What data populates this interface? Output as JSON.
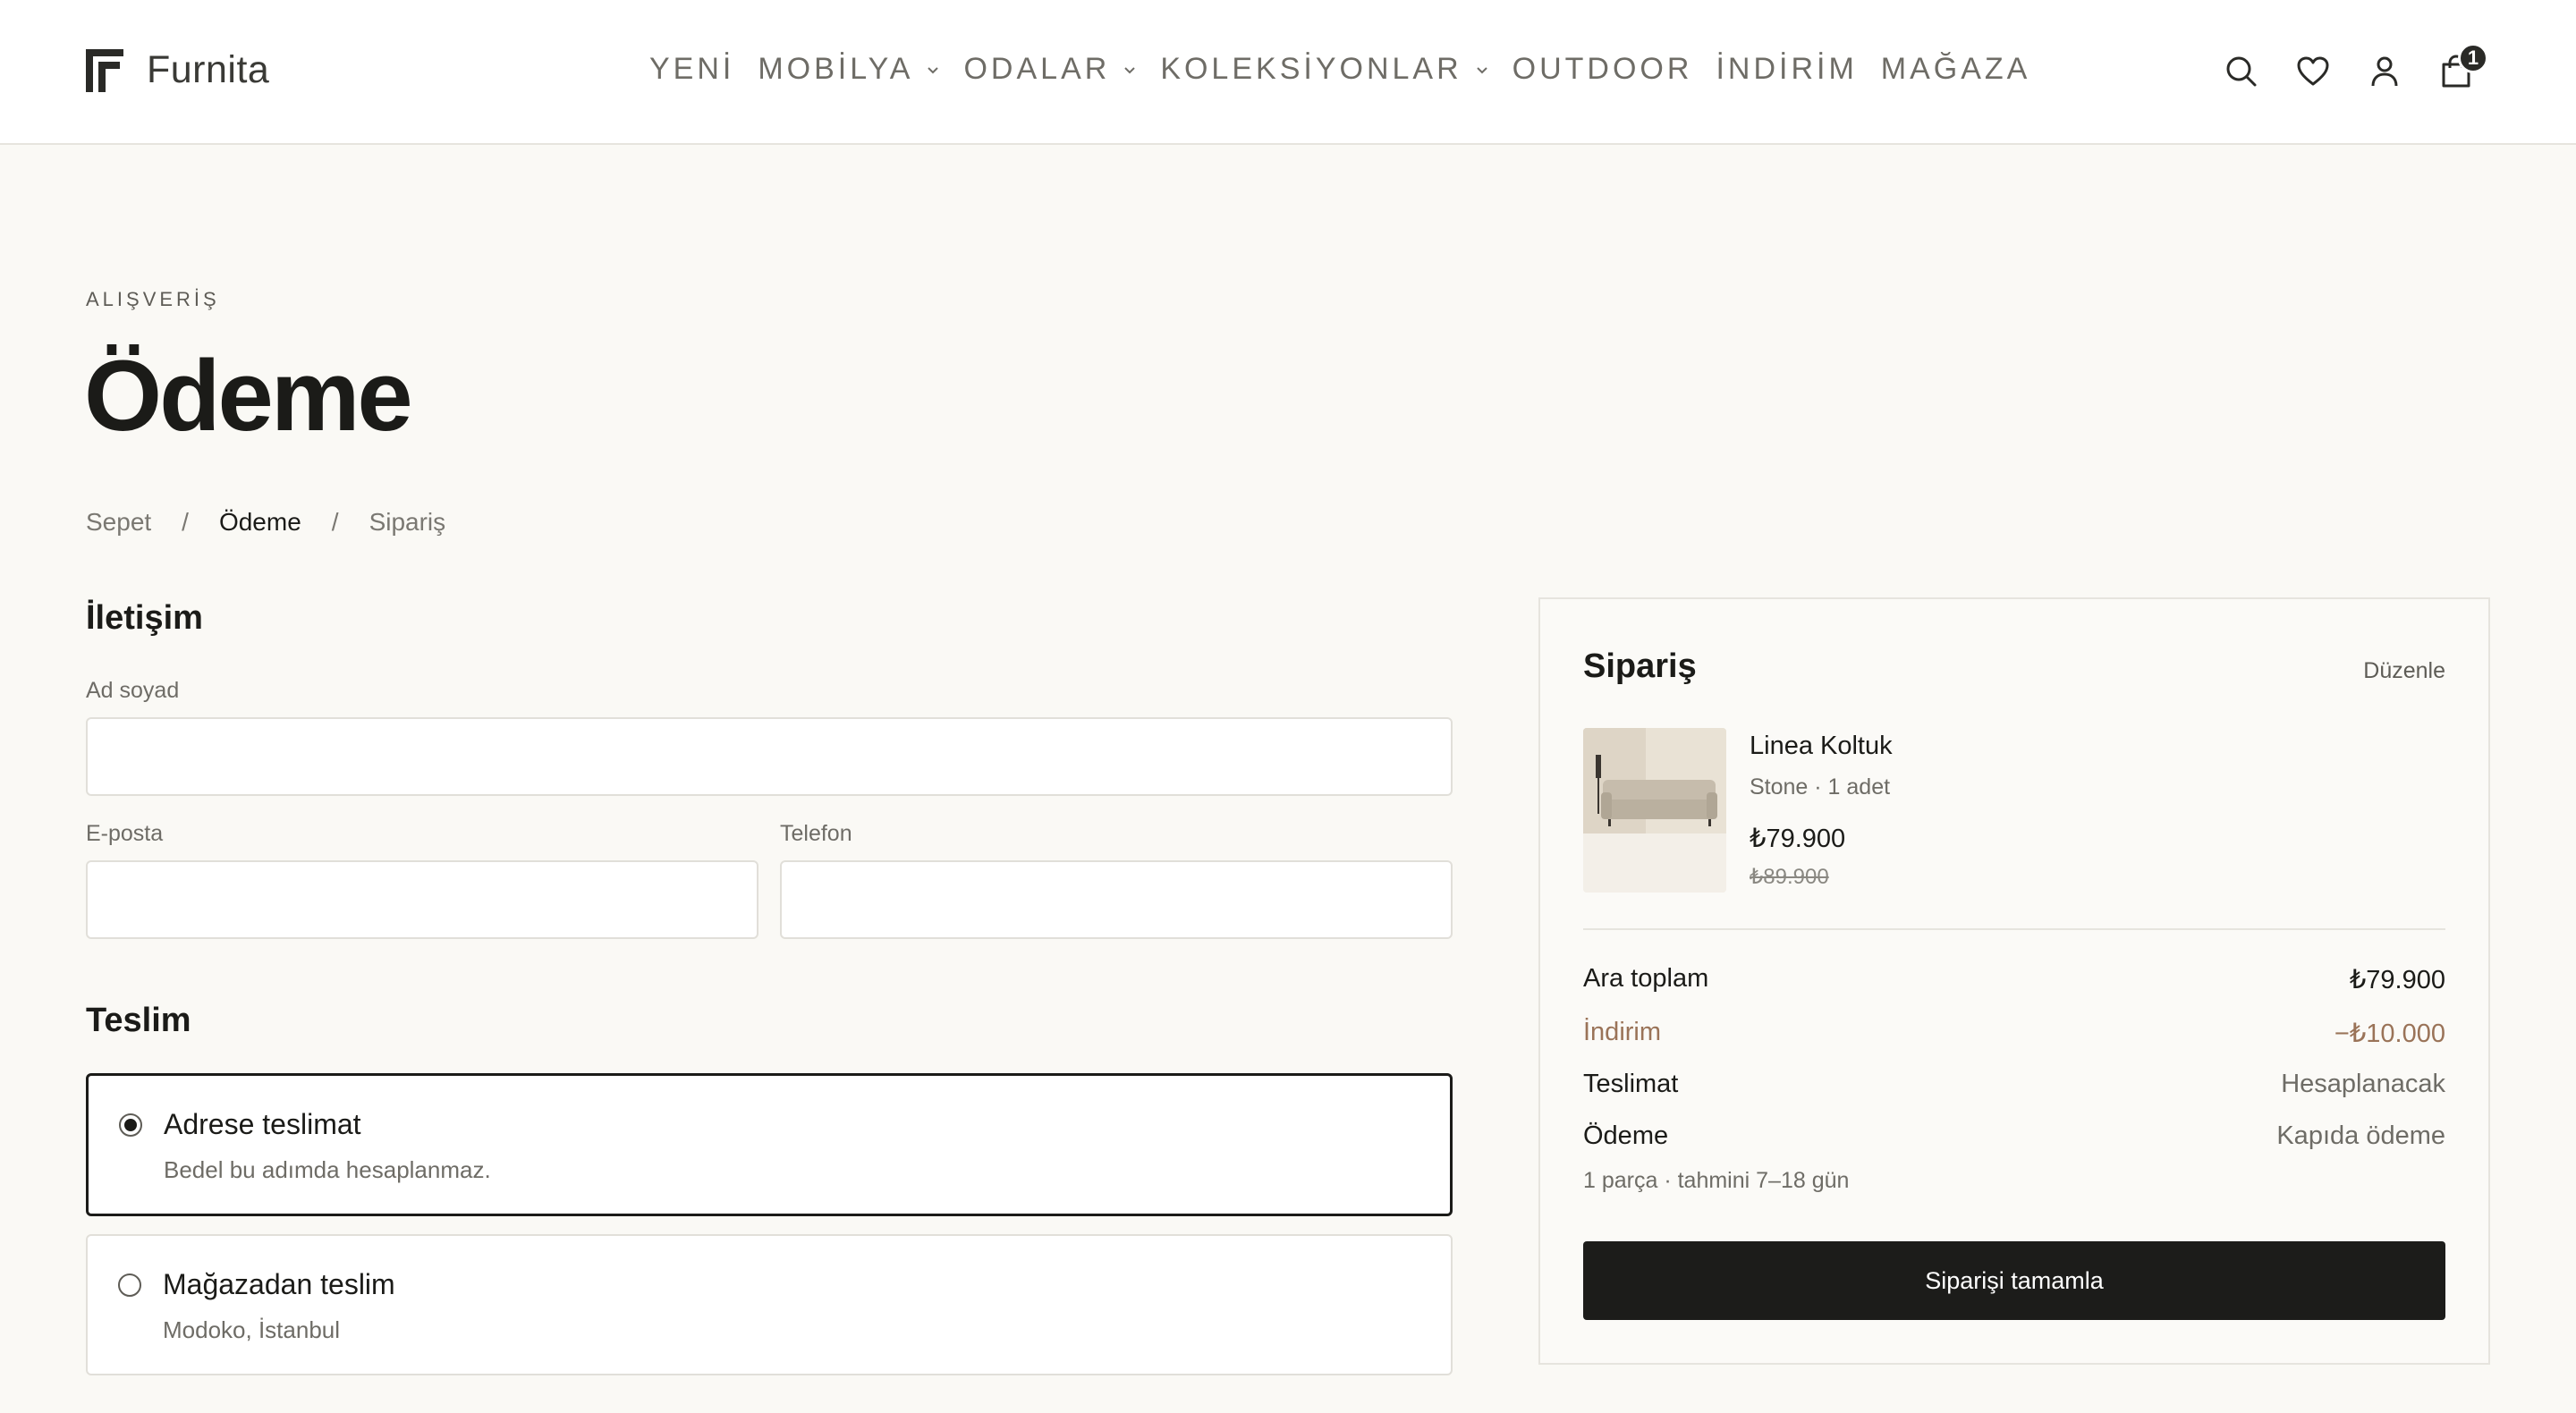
{
  "brand": {
    "name": "Furnita"
  },
  "nav": {
    "items": [
      {
        "label": "YENİ",
        "has_dropdown": false
      },
      {
        "label": "MOBİLYA",
        "has_dropdown": true
      },
      {
        "label": "ODALAR",
        "has_dropdown": true
      },
      {
        "label": "KOLEKSİYONLAR",
        "has_dropdown": true
      },
      {
        "label": "OUTDOOR",
        "has_dropdown": false
      },
      {
        "label": "İNDİRİM",
        "has_dropdown": false
      },
      {
        "label": "MAĞAZA",
        "has_dropdown": false
      }
    ]
  },
  "header_icons": [
    "search-icon",
    "heart-icon",
    "user-icon",
    "cart-icon"
  ],
  "cart": {
    "count": "1"
  },
  "page": {
    "eyebrow": "ALIŞVERİŞ",
    "title": "Ödeme"
  },
  "breadcrumb": {
    "items": [
      "Sepet",
      "Ödeme",
      "Sipariş"
    ],
    "separator": "/",
    "current_index": 1
  },
  "contact": {
    "title": "İletişim",
    "name_label": "Ad soyad",
    "name_value": "",
    "email_label": "E-posta",
    "email_value": "",
    "phone_label": "Telefon",
    "phone_value": ""
  },
  "delivery": {
    "title": "Teslim",
    "options": [
      {
        "title": "Adrese teslimat",
        "subtitle": "Bedel bu adımda hesaplanmaz.",
        "selected": true
      },
      {
        "title": "Mağazadan teslim",
        "subtitle": "Modoko, İstanbul",
        "selected": false
      }
    ]
  },
  "summary": {
    "title": "Sipariş",
    "edit_label": "Düzenle",
    "product": {
      "name": "Linea Koltuk",
      "variant": "Stone · 1 adet",
      "price": "₺79.900",
      "old_price": "₺89.900"
    },
    "rows": {
      "subtotal_label": "Ara toplam",
      "subtotal_value": "₺79.900",
      "discount_label": "İndirim",
      "discount_value": "−₺10.000",
      "shipping_label": "Teslimat",
      "shipping_value": "Hesaplanacak",
      "payment_label": "Ödeme",
      "payment_value": "Kapıda ödeme"
    },
    "note": "1 parça · tahmini 7–18 gün",
    "cta_label": "Siparişi tamamla"
  },
  "colors": {
    "background": "#faf9f5",
    "text": "#1b1b18",
    "muted": "#6e6c66",
    "discount": "#9a7358",
    "button": "#1c1c1a"
  }
}
